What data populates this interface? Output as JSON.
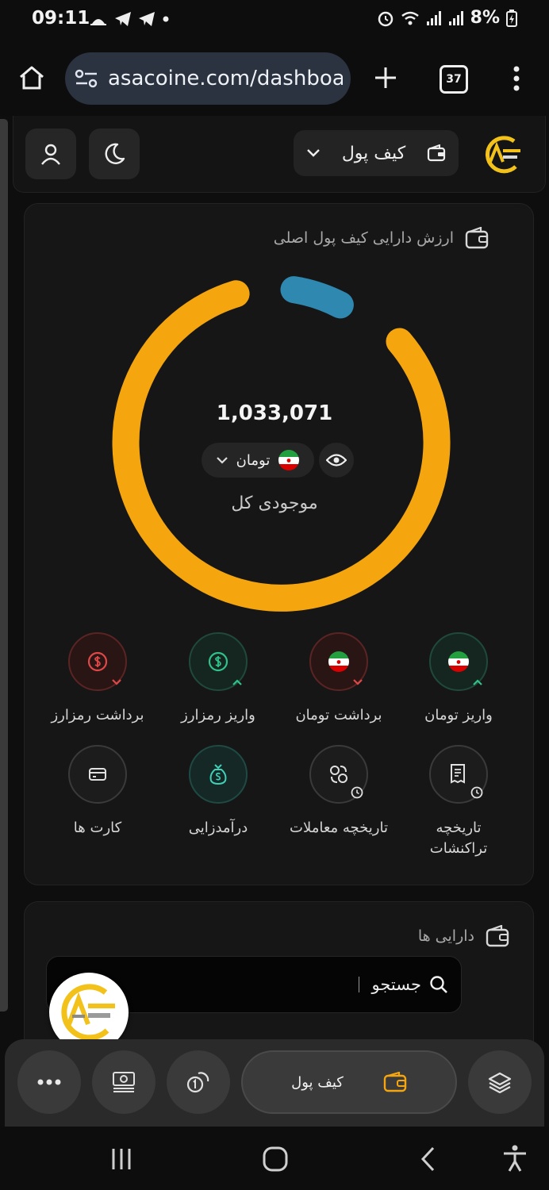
{
  "status": {
    "time": "09:11",
    "battery": "8%"
  },
  "browser": {
    "url": "asacoine.com/dashboa",
    "tab_count": "37"
  },
  "header": {
    "wallet_select": "کیف پول"
  },
  "main_card": {
    "title": "ارزش دارایی کیف پول اصلی",
    "total_amount": "1,033,071",
    "currency": "تومان",
    "total_label": "موجودی کل"
  },
  "actions": [
    {
      "label": "واریز تومان"
    },
    {
      "label": "برداشت تومان"
    },
    {
      "label": "واریز رمزارز"
    },
    {
      "label": "برداشت رمزارز"
    },
    {
      "label": "تاریخچه تراکنشات"
    },
    {
      "label": "تاریخچه معاملات"
    },
    {
      "label": "درآمدزایی"
    },
    {
      "label": "کارت ها"
    }
  ],
  "assets": {
    "title": "دارایی ها",
    "search_placeholder": "جستجو"
  },
  "bottom_nav": {
    "wallet_label": "کیف پول"
  },
  "colors": {
    "accent": "#f5a50e",
    "donut_secondary": "#2f88b0",
    "card_bg": "#161616"
  }
}
